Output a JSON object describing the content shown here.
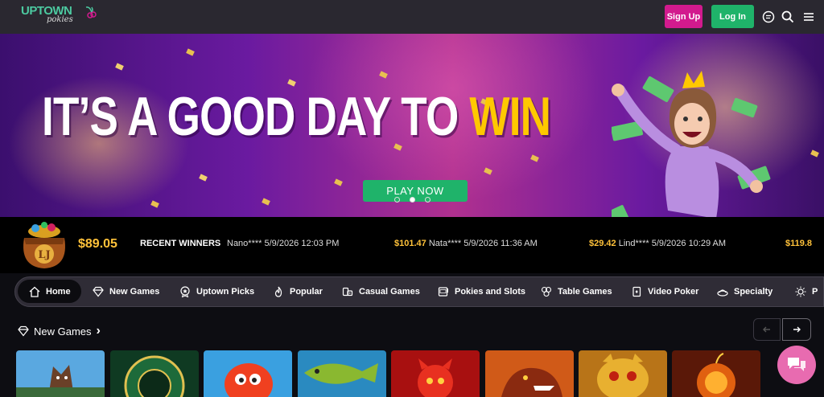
{
  "header": {
    "logo_main": "UPTOWN",
    "logo_sub": "pokies",
    "signup_label": "Sign Up",
    "login_label": "Log In",
    "icons": [
      "chat-bubble-icon",
      "search-icon",
      "menu-icon"
    ]
  },
  "hero": {
    "title_prefix": "IT’S A GOOD DAY TO",
    "title_highlight": "WIN",
    "cta_label": "PLAY NOW",
    "slide_count": 3,
    "active_slide": 2
  },
  "winners": {
    "jackpot": "$89.05",
    "label": "RECENT WINNERS",
    "entries": [
      {
        "amount": "",
        "text": "Nano**** 5/9/2026 12:03 PM"
      },
      {
        "amount": "$101.47",
        "text": "Nata**** 5/9/2026 11:36 AM"
      },
      {
        "amount": "$29.42",
        "text": "Lind**** 5/9/2026 10:29 AM"
      },
      {
        "amount": "$119.8",
        "text": ""
      }
    ]
  },
  "categories": [
    {
      "label": "Home",
      "icon": "home-icon",
      "active": true
    },
    {
      "label": "New Games",
      "icon": "diamond-icon"
    },
    {
      "label": "Uptown Picks",
      "icon": "badge-star-icon"
    },
    {
      "label": "Popular",
      "icon": "fire-icon"
    },
    {
      "label": "Casual Games",
      "icon": "cards-dice-icon"
    },
    {
      "label": "Pokies and Slots",
      "icon": "slot-machine-icon"
    },
    {
      "label": "Table Games",
      "icon": "chips-icon"
    },
    {
      "label": "Video Poker",
      "icon": "poker-card-icon"
    },
    {
      "label": "Specialty",
      "icon": "specialty-icon"
    },
    {
      "label": "P",
      "icon": "sun-icon"
    }
  ],
  "section": {
    "title": "New Games",
    "chevron": "›"
  },
  "games": [
    {
      "name": "wolf-game",
      "color": "#3a8fd0"
    },
    {
      "name": "roulette-game",
      "color": "#1d6a3a"
    },
    {
      "name": "fire-blob-game",
      "color": "#3aa0e0"
    },
    {
      "name": "big-bass-game",
      "color": "#2a8ac0"
    },
    {
      "name": "fire-devil-game",
      "color": "#c01818"
    },
    {
      "name": "dragon-fire-game",
      "color": "#d05a18"
    },
    {
      "name": "golden-dragon-game",
      "color": "#b87418"
    },
    {
      "name": "fire-bomb-game",
      "color": "#a02810"
    }
  ],
  "colors": {
    "signup": "#d21a8e",
    "login": "#1fb36a",
    "gold": "#ffc23a",
    "chat": "#e86bb0"
  }
}
